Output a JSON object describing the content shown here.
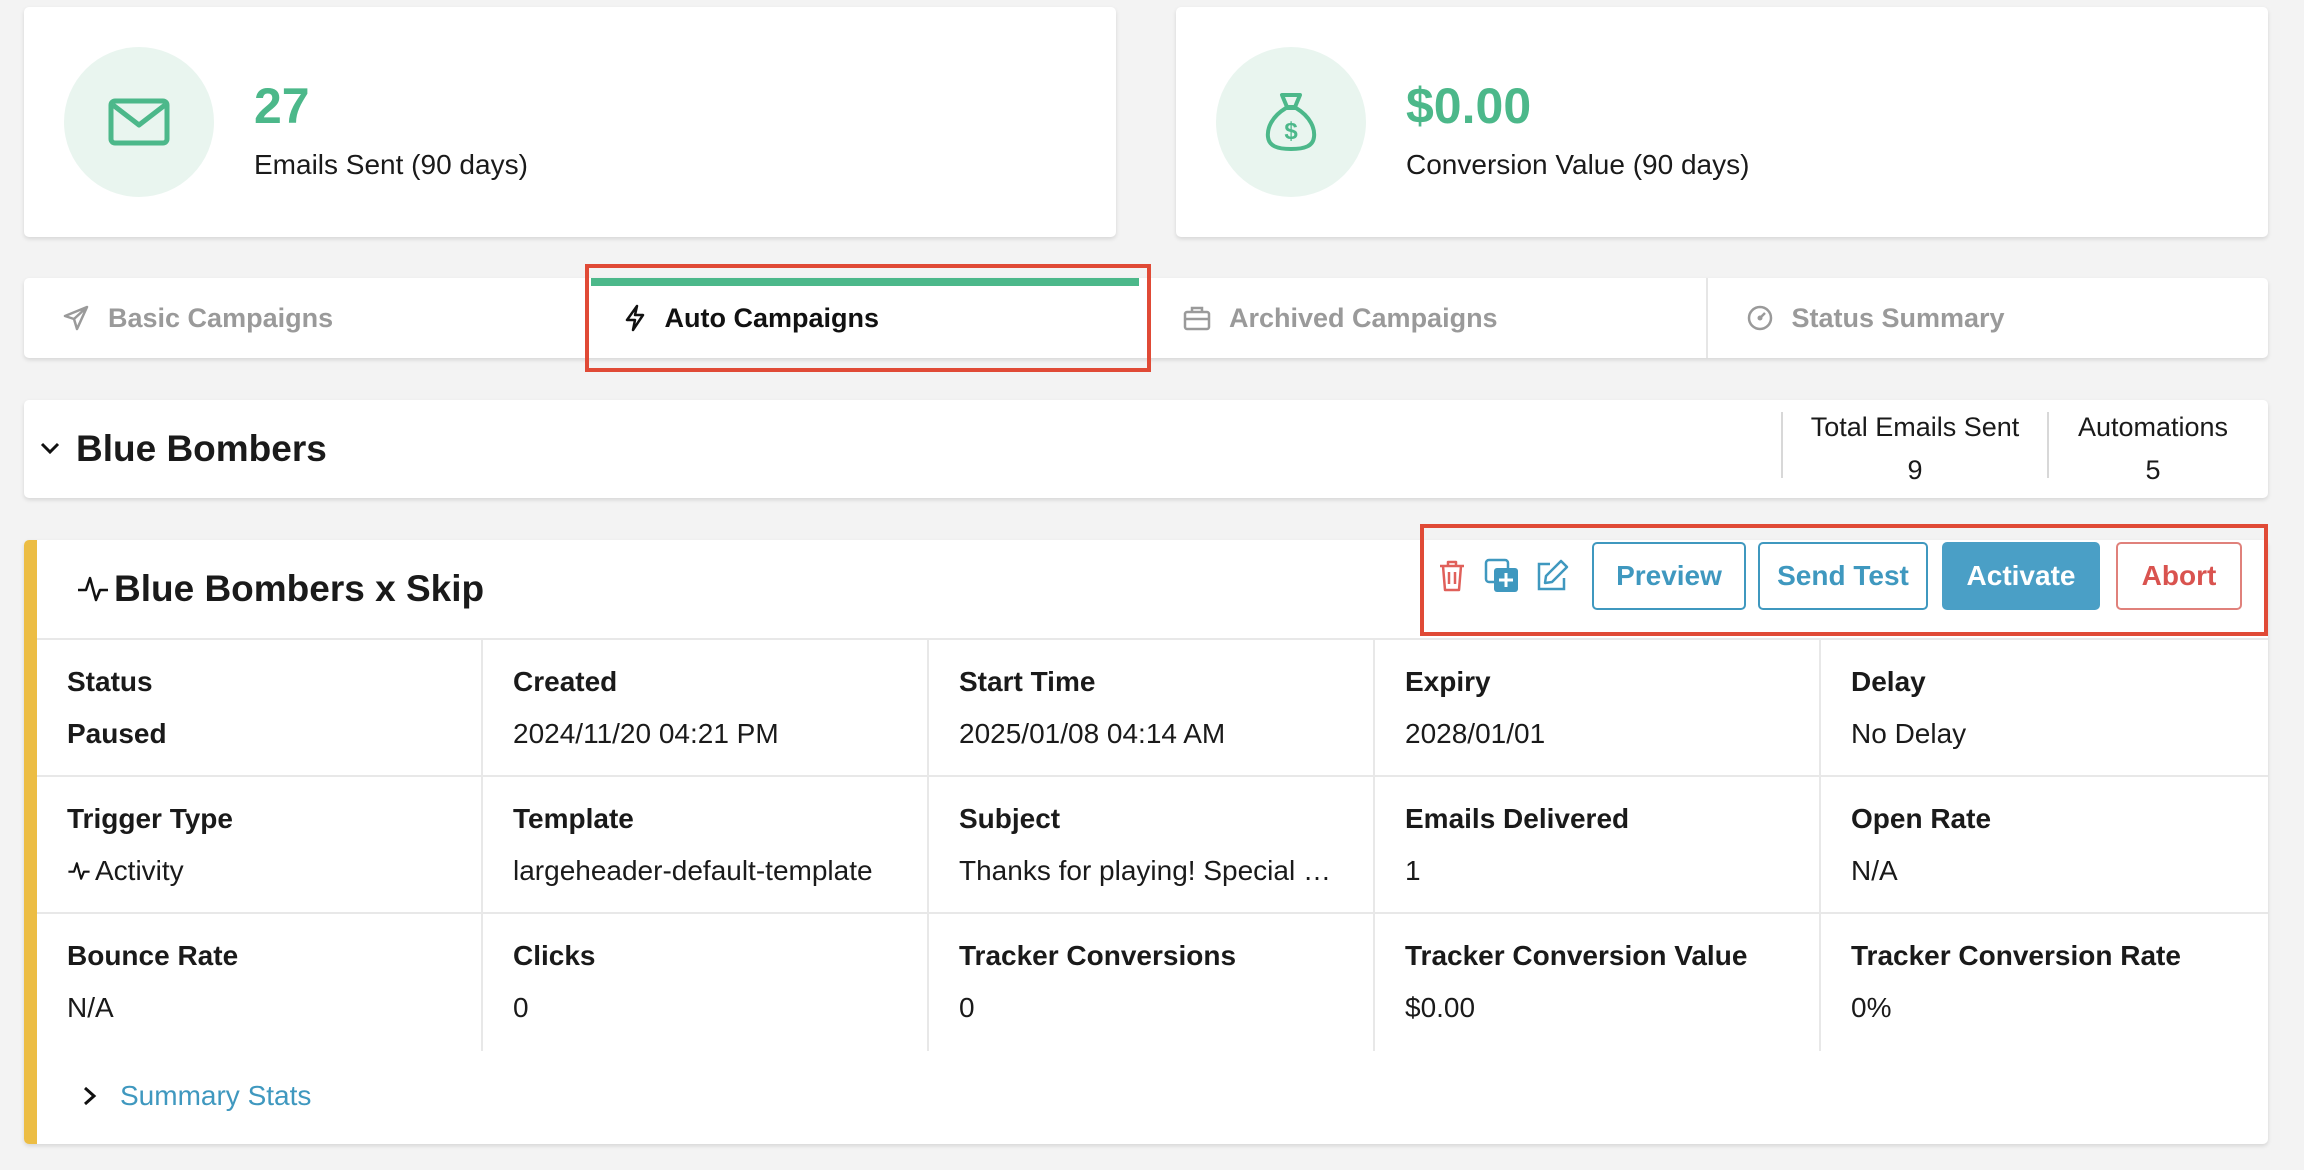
{
  "stats": {
    "emails": {
      "value": "27",
      "label": "Emails Sent (90 days)",
      "icon": "envelope-icon"
    },
    "conversion": {
      "value": "$0.00",
      "label": "Conversion Value (90 days)",
      "icon": "money-bag-icon"
    }
  },
  "tabs": [
    {
      "label": "Basic Campaigns",
      "icon": "paper-plane-icon"
    },
    {
      "label": "Auto Campaigns",
      "icon": "lightning-icon",
      "active": true
    },
    {
      "label": "Archived Campaigns",
      "icon": "briefcase-icon"
    },
    {
      "label": "Status Summary",
      "icon": "gauge-icon"
    }
  ],
  "group": {
    "title": "Blue Bombers",
    "total_label": "Total Emails Sent",
    "total_value": "9",
    "automations_label": "Automations",
    "automations_value": "5"
  },
  "campaign": {
    "title": "Blue Bombers x Skip",
    "buttons": {
      "preview": "Preview",
      "send_test": "Send Test",
      "activate": "Activate",
      "abort": "Abort"
    },
    "fields": [
      {
        "k": "Status",
        "v": "Paused"
      },
      {
        "k": "Created",
        "v": "2024/11/20 04:21 PM"
      },
      {
        "k": "Start Time",
        "v": "2025/01/08 04:14 AM"
      },
      {
        "k": "Expiry",
        "v": "2028/01/01"
      },
      {
        "k": "Delay",
        "v": "No Delay"
      },
      {
        "k": "Trigger Type",
        "v": "Activity"
      },
      {
        "k": "Template",
        "v": "largeheader-default-template"
      },
      {
        "k": "Subject",
        "v": "Thanks for playing! Special Sk..."
      },
      {
        "k": "Emails Delivered",
        "v": "1"
      },
      {
        "k": "Open Rate",
        "v": "N/A"
      },
      {
        "k": "Bounce Rate",
        "v": "N/A"
      },
      {
        "k": "Clicks",
        "v": "0"
      },
      {
        "k": "Tracker Conversions",
        "v": "0"
      },
      {
        "k": "Tracker Conversion Value",
        "v": "$0.00"
      },
      {
        "k": "Tracker Conversion Rate",
        "v": "0%"
      }
    ],
    "summary_link": "Summary Stats"
  },
  "colors": {
    "green": "#4cb88a",
    "blue": "#3f98bf",
    "accent_yellow": "#ecbd44",
    "red": "#d9534f",
    "highlight": "#e04a36"
  }
}
